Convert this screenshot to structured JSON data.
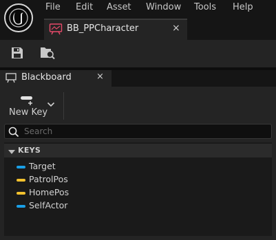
{
  "menu": [
    "File",
    "Edit",
    "Asset",
    "Window",
    "Tools",
    "Help"
  ],
  "document_tab": {
    "title": "BB_PPCharacter",
    "close": "×"
  },
  "panel_tab": {
    "title": "Blackboard",
    "close": "×"
  },
  "toolbar": {
    "save_icon": "save-icon",
    "browse_icon": "browse-asset-icon"
  },
  "new_key": {
    "label": "New Key",
    "dropdown_icon": "chevron-down-icon"
  },
  "search": {
    "placeholder": "Search"
  },
  "keys": {
    "header": "KEYS",
    "items": [
      {
        "name": "Target",
        "color": "#1a9fe6"
      },
      {
        "name": "PatrolPos",
        "color": "#f2c12e"
      },
      {
        "name": "HomePos",
        "color": "#f2c12e"
      },
      {
        "name": "SelfActor",
        "color": "#1a9fe6"
      }
    ]
  },
  "colors": {
    "background": "#151515",
    "panel": "#242424",
    "doc_tab_icon": "#e84a6a",
    "object_key": "#1a9fe6",
    "vector_key": "#f2c12e"
  }
}
